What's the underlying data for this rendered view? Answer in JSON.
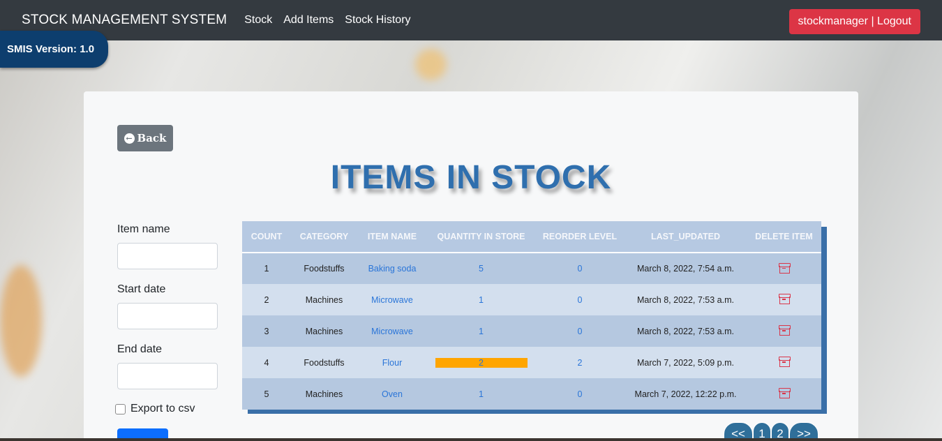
{
  "navbar": {
    "brand": "STOCK MANAGEMENT SYSTEM",
    "links": [
      "Stock",
      "Add Items",
      "Stock History"
    ],
    "logout": "stockmanager | Logout"
  },
  "version": "SMIS Version: 1.0",
  "back_label": "Back",
  "page_title": "ITEMS IN STOCK",
  "filters": {
    "item_name_label": "Item name",
    "start_date_label": "Start date",
    "end_date_label": "End date",
    "export_label": "Export to csv"
  },
  "table": {
    "headers": [
      "COUNT",
      "CATEGORY",
      "ITEM NAME",
      "QUANTITY IN STORE",
      "REORDER LEVEL",
      "LAST_UPDATED",
      "DELETE ITEM"
    ],
    "rows": [
      {
        "count": "1",
        "category": "Foodstuffs",
        "name": "Baking soda",
        "qty": "5",
        "reorder": "0",
        "updated": "March 8, 2022, 7:54 a.m."
      },
      {
        "count": "2",
        "category": "Machines",
        "name": "Microwave",
        "qty": "1",
        "reorder": "0",
        "updated": "March 8, 2022, 7:53 a.m."
      },
      {
        "count": "3",
        "category": "Machines",
        "name": "Microwave",
        "qty": "1",
        "reorder": "0",
        "updated": "March 8, 2022, 7:53 a.m."
      },
      {
        "count": "4",
        "category": "Foodstuffs",
        "name": "Flour",
        "qty": "2",
        "reorder": "2",
        "updated": "March 7, 2022, 5:09 p.m."
      },
      {
        "count": "5",
        "category": "Machines",
        "name": "Oven",
        "qty": "1",
        "reorder": "0",
        "updated": "March 7, 2022, 12:22 p.m."
      }
    ]
  },
  "pagination": [
    "<<",
    "1",
    "2",
    ">>"
  ],
  "colors": {
    "navbar": "#343a40",
    "logout": "#dc3545",
    "title": "#2f6fae",
    "low_stock_highlight": "#ffa500"
  }
}
